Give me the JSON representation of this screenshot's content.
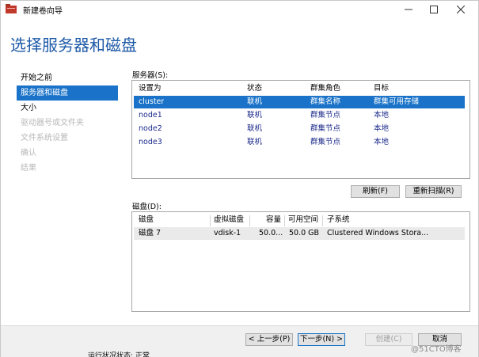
{
  "window": {
    "title": "新建卷向导",
    "icon": "red-folder-icon"
  },
  "page_title": "选择服务器和磁盘",
  "nav": {
    "items": [
      {
        "label": "开始之前",
        "state": "normal"
      },
      {
        "label": "服务器和磁盘",
        "state": "active"
      },
      {
        "label": "大小",
        "state": "normal"
      },
      {
        "label": "驱动器号或文件夹",
        "state": "disabled"
      },
      {
        "label": "文件系统设置",
        "state": "disabled"
      },
      {
        "label": "确认",
        "state": "disabled"
      },
      {
        "label": "结果",
        "state": "disabled"
      }
    ]
  },
  "servers": {
    "label": "服务器(S):",
    "columns": [
      "设置为",
      "状态",
      "群集角色",
      "目标"
    ],
    "rows": [
      {
        "name": "cluster",
        "status": "联机",
        "role": "群集名称",
        "target": "群集可用存储"
      },
      {
        "name": "node1",
        "status": "联机",
        "role": "群集节点",
        "target": "本地"
      },
      {
        "name": "node2",
        "status": "联机",
        "role": "群集节点",
        "target": "本地"
      },
      {
        "name": "node3",
        "status": "联机",
        "role": "群集节点",
        "target": "本地"
      }
    ]
  },
  "buttons": {
    "refresh": "刷新(F)",
    "rescan": "重新扫描(R)",
    "back": "< 上一步(P)",
    "next": "下一步(N) >",
    "create": "创建(C)",
    "cancel": "取消"
  },
  "disks": {
    "label": "磁盘(D):",
    "columns": [
      "磁盘",
      "虚拟磁盘",
      "容量",
      "可用空间",
      "子系统"
    ],
    "rows": [
      {
        "disk": "磁盘 7",
        "vdisk": "vdisk-1",
        "capacity": "50.0...",
        "free": "50.0 GB",
        "subsystem": "Clustered Windows Stora..."
      }
    ]
  },
  "background_text": "运行状况状态: 正常",
  "watermark": "@51CTO博客",
  "colors": {
    "accent": "#1a73c8",
    "title_blue": "#1e5aa8",
    "node_text": "#1b2a8a"
  }
}
